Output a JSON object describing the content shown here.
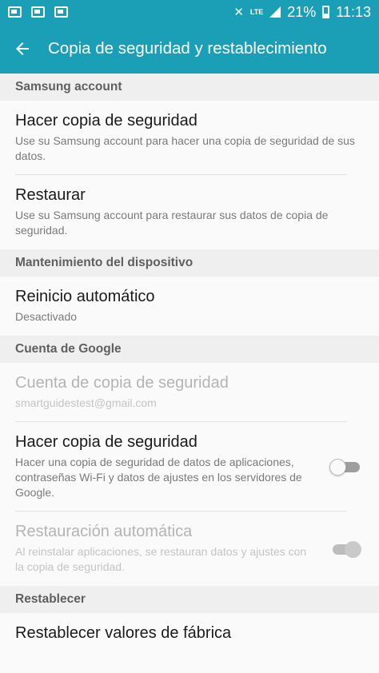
{
  "status": {
    "network": "LTE",
    "battery_text": "21%",
    "time": "11:13",
    "icons": [
      "gallery-icon",
      "message-icon",
      "message-icon",
      "mute-icon",
      "signal-icon",
      "battery-icon"
    ]
  },
  "appbar": {
    "title": "Copia de seguridad y restablecimiento",
    "back_icon": "arrow-left-icon",
    "color": "#1a9fb6"
  },
  "sections": {
    "samsung": {
      "header": "Samsung account",
      "backup": {
        "title": "Hacer copia de seguridad",
        "summary": "Use su Samsung account para hacer una copia de seguridad de sus datos."
      },
      "restore": {
        "title": "Restaurar",
        "summary": "Use su Samsung account para restaurar sus datos de copia de seguridad."
      }
    },
    "maintenance": {
      "header": "Mantenimiento del dispositivo",
      "auto_restart": {
        "title": "Reinicio automático",
        "summary": "Desactivado"
      }
    },
    "google": {
      "header": "Cuenta de Google",
      "backup_account": {
        "title": "Cuenta de copia de seguridad",
        "summary": "smartguidestest@gmail.com"
      },
      "backup": {
        "title": "Hacer copia de seguridad",
        "summary": "Hacer una copia de seguridad de datos de aplicaciones, contraseñas Wi-Fi y datos de ajustes en los servidores de Google.",
        "switch_on": false
      },
      "auto_restore": {
        "title": "Restauración automática",
        "summary": "Al reinstalar aplicaciones, se restauran datos y ajustes con la copia de seguridad.",
        "switch_on": true
      }
    },
    "reset": {
      "header": "Restablecer",
      "factory": {
        "title": "Restablecer valores de fábrica"
      }
    }
  }
}
